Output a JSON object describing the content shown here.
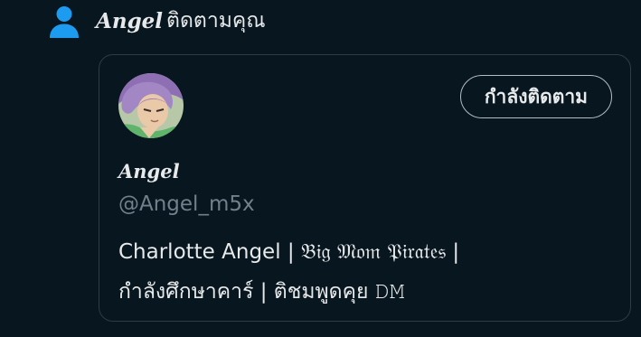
{
  "notification": {
    "icon": "person-icon",
    "name": "𝑨𝒏𝒈𝒆𝒍",
    "text": "ติดตามคุณ"
  },
  "profile_card": {
    "avatar": "avatar-image",
    "follow_button_label": "กำลังติดตาม",
    "display_name": "𝑨𝒏𝒈𝒆𝒍",
    "handle": "@Angel_m5x",
    "bio_line1": "Charlotte Angel | 𝔅𝔦𝔤 𝔐𝔬𝔪 𝔓𝔦𝔯𝔞𝔱𝔢𝔰 |",
    "bio_line2": "กำลังศึกษาคาร์ | ติชมพูดคุย 𝙳𝙼"
  },
  "colors": {
    "background": "#07161f",
    "accent_icon": "#1d9bf0",
    "border": "#2f3c45",
    "muted_text": "#71808b"
  }
}
